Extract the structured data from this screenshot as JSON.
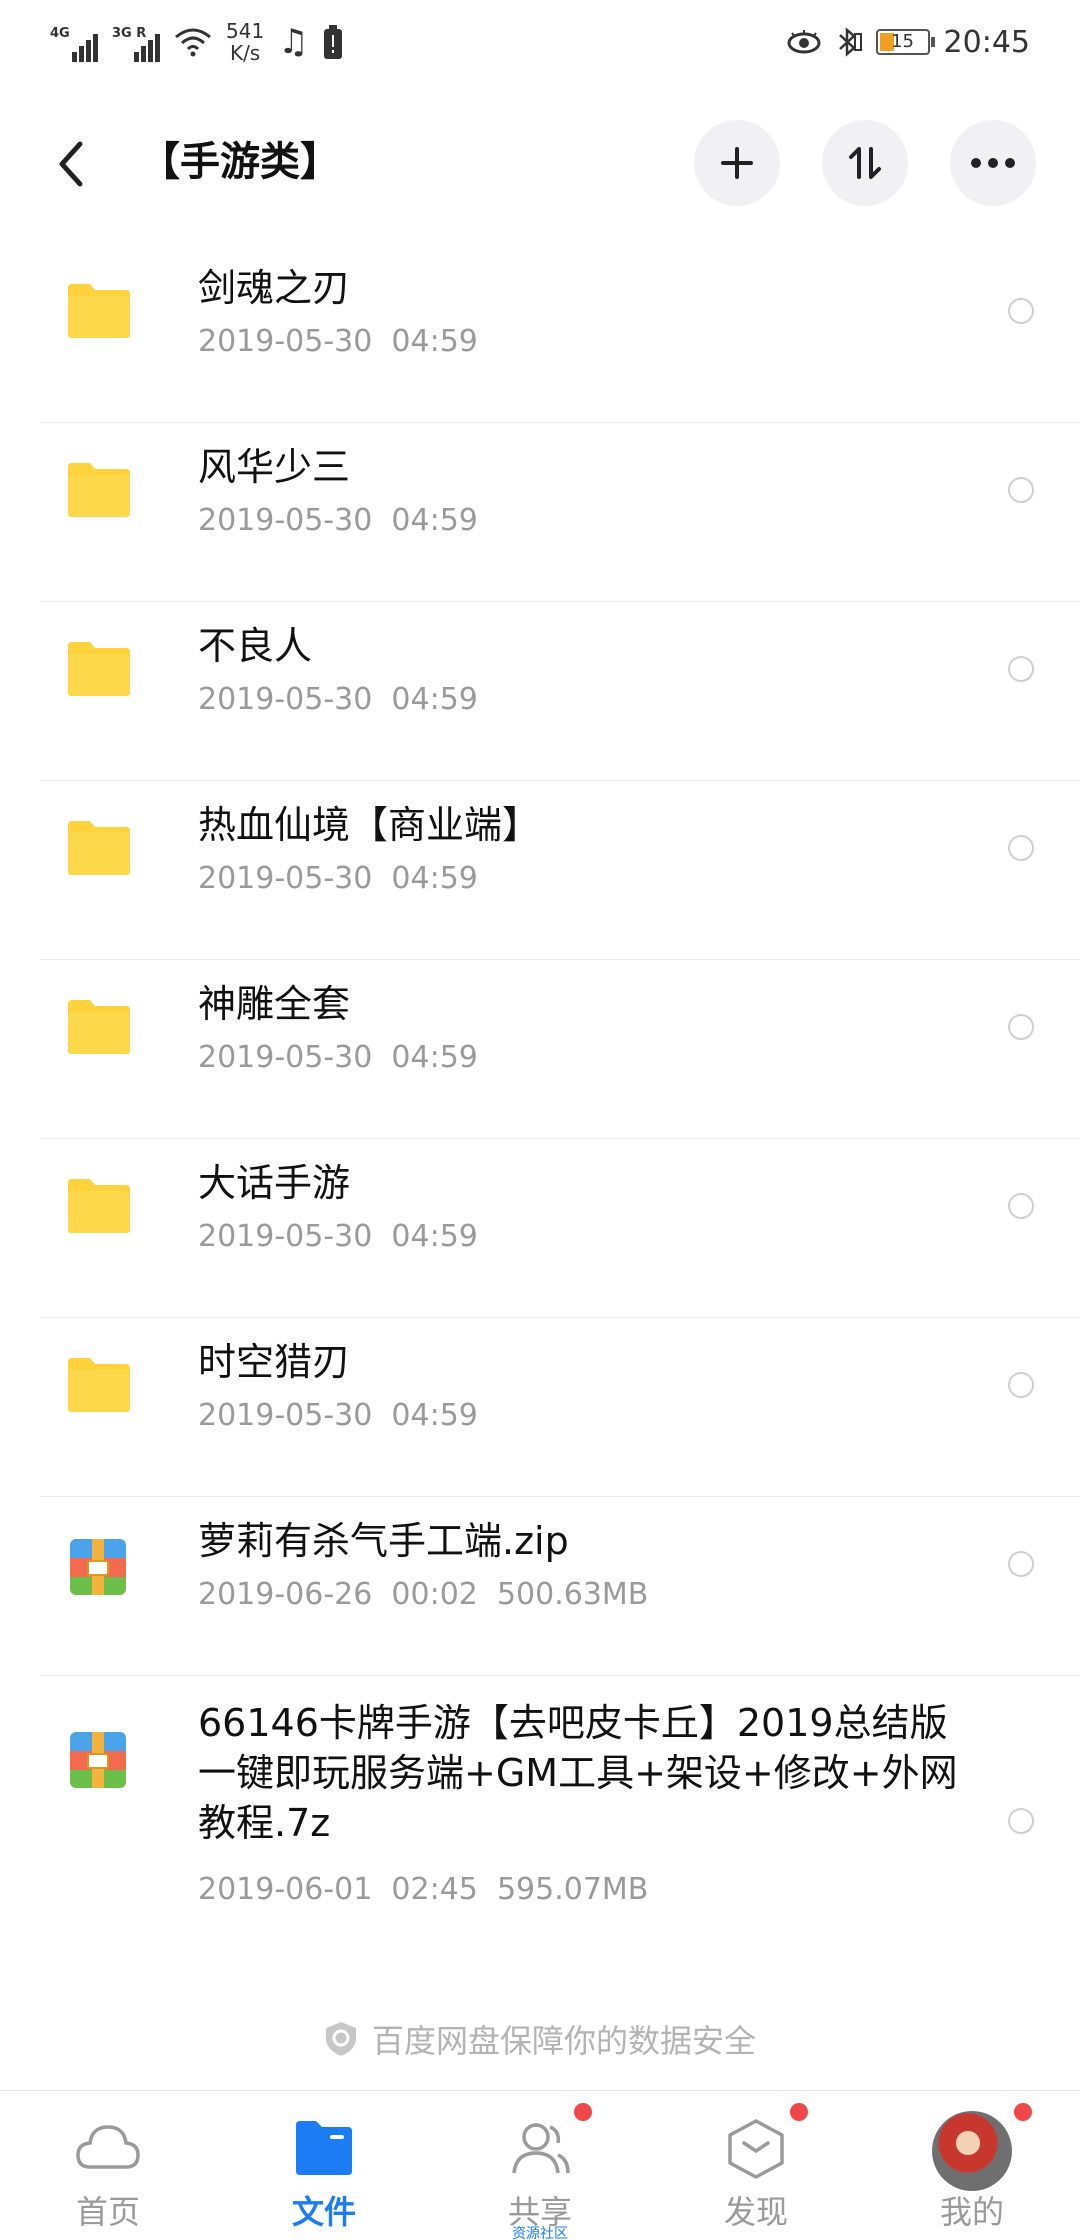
{
  "status_bar": {
    "signal_1_label": "4G",
    "signal_2_label": "3G R",
    "net_speed_value": "541",
    "net_speed_unit": "K/s",
    "battery_level": "15",
    "time": "20:45"
  },
  "header": {
    "title": "【手游类】"
  },
  "files": [
    {
      "name": "剑魂之刃",
      "meta": "2019-05-30  04:59",
      "type": "folder"
    },
    {
      "name": "风华少三",
      "meta": "2019-05-30  04:59",
      "type": "folder"
    },
    {
      "name": "不良人",
      "meta": "2019-05-30  04:59",
      "type": "folder"
    },
    {
      "name": "热血仙境【商业端】",
      "meta": "2019-05-30  04:59",
      "type": "folder"
    },
    {
      "name": "神雕全套",
      "meta": "2019-05-30  04:59",
      "type": "folder"
    },
    {
      "name": "大话手游",
      "meta": "2019-05-30  04:59",
      "type": "folder"
    },
    {
      "name": "时空猎刃",
      "meta": "2019-05-30  04:59",
      "type": "folder"
    },
    {
      "name": "萝莉有杀气手工端.zip",
      "meta": "2019-06-26  00:02  500.63MB",
      "type": "archive"
    },
    {
      "name": "66146卡牌手游【去吧皮卡丘】2019总结版一键即玩服务端+GM工具+架设+修改+外网教程.7z",
      "meta": "2019-06-01  02:45  595.07MB",
      "type": "archive"
    }
  ],
  "footer_note": "百度网盘保障你的数据安全",
  "nav": {
    "home": "首页",
    "files": "文件",
    "share": "共享",
    "share_sub": "资源社区",
    "discover": "发现",
    "mine": "我的"
  },
  "colors": {
    "accent": "#1b7cf3",
    "folder": "#fdd23a",
    "badge": "#f04848"
  }
}
